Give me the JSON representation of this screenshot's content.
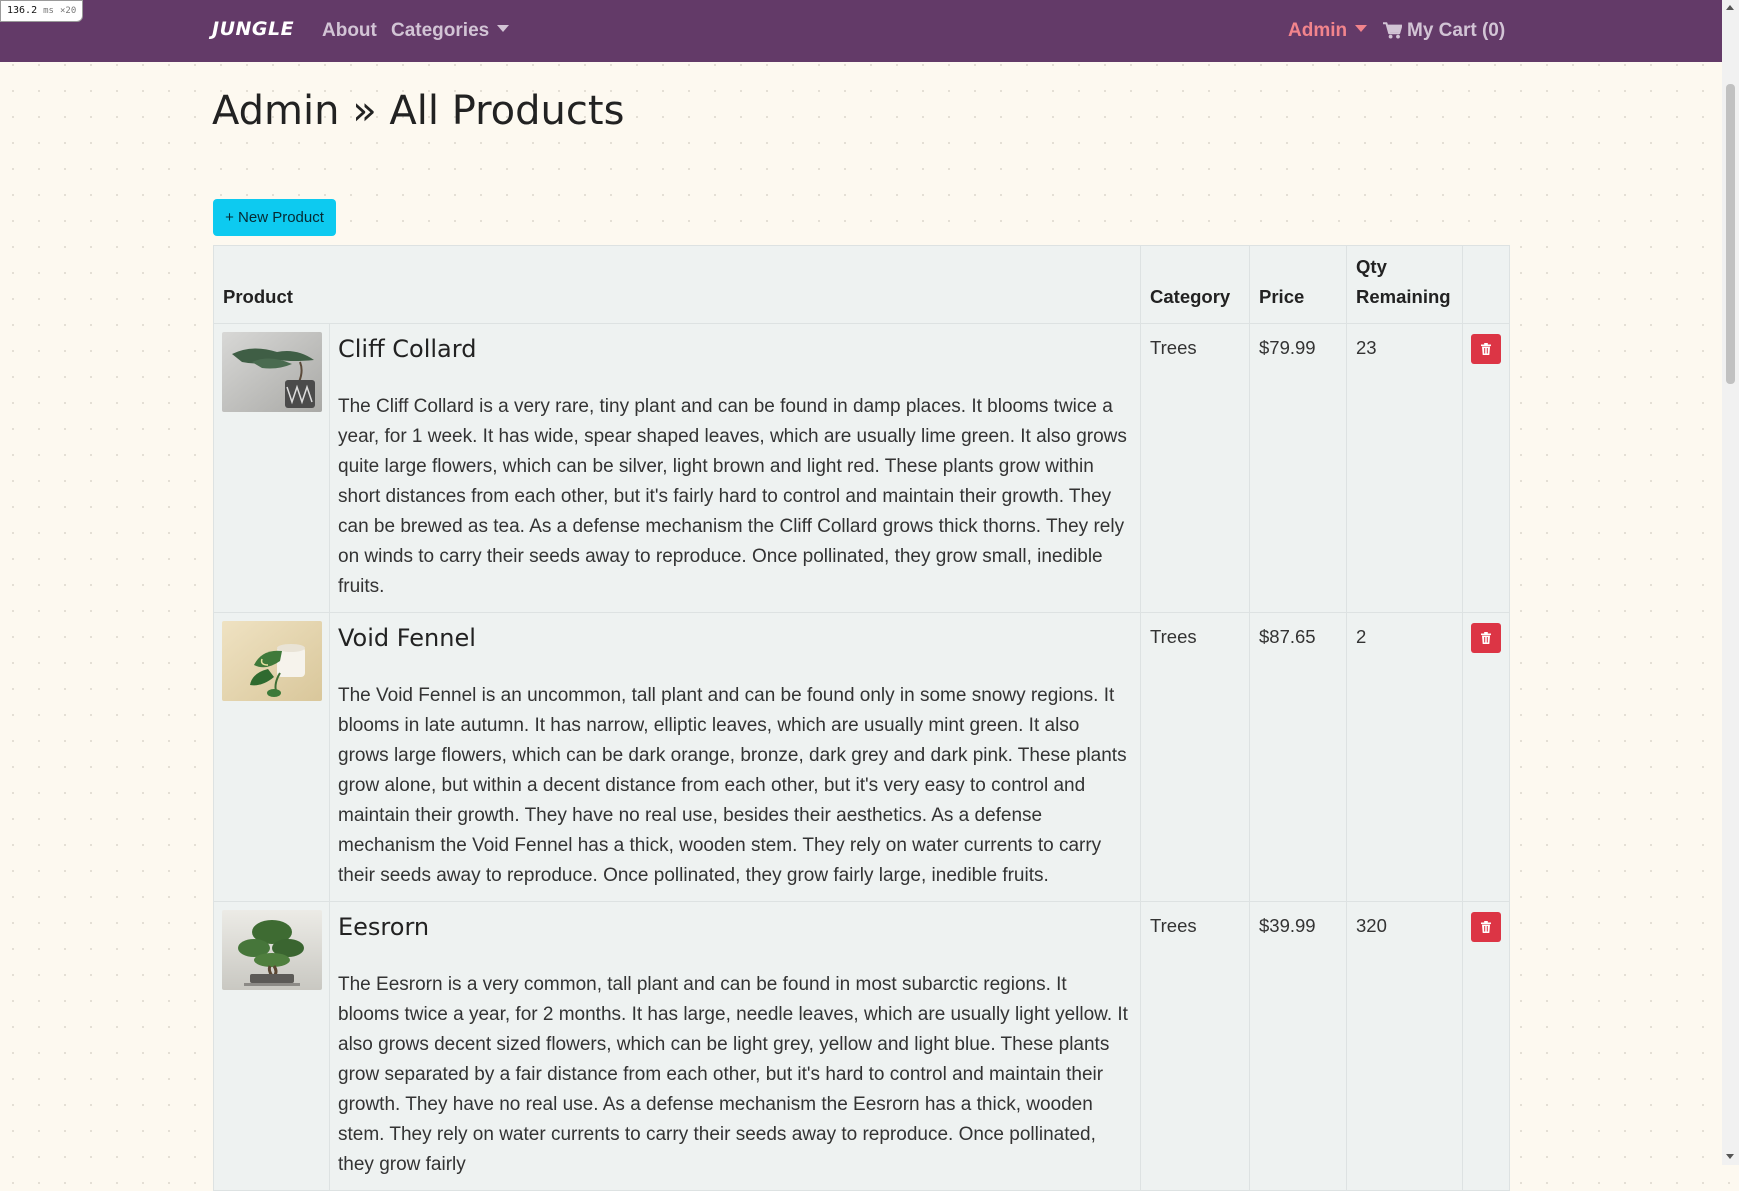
{
  "perf_overlay": {
    "value": "136.2",
    "unit": "ms",
    "multiplier": "×20"
  },
  "navbar": {
    "brand": "JUNGLE",
    "about": "About",
    "categories": "Categories",
    "admin": "Admin",
    "cart": "My Cart (0)",
    "colors": {
      "background": "#633a68",
      "link": "#d2c4d5",
      "admin": "#f2848c"
    }
  },
  "page": {
    "title": "Admin » All Products",
    "new_product_button": "+ New Product"
  },
  "table": {
    "headers": {
      "product": "Product",
      "category": "Category",
      "price": "Price",
      "qty": "Qty Remaining"
    },
    "rows": [
      {
        "name": "Cliff Collard",
        "description": "The Cliff Collard is a very rare, tiny plant and can be found in damp places. It blooms twice a year, for 1 week. It has wide, spear shaped leaves, which are usually lime green. It also grows quite large flowers, which can be silver, light brown and light red. These plants grow within short distances from each other, but it's fairly hard to control and maintain their growth. They can be brewed as tea. As a defense mechanism the Cliff Collard grows thick thorns. They rely on winds to carry their seeds away to reproduce. Once pollinated, they grow small, inedible fruits.",
        "category": "Trees",
        "price": "$79.99",
        "qty": "23",
        "image": "juniper-bonsai-in-patterned-pot"
      },
      {
        "name": "Void Fennel",
        "description": "The Void Fennel is an uncommon, tall plant and can be found only in some snowy regions. It blooms in late autumn. It has narrow, elliptic leaves, which are usually mint green. It also grows large flowers, which can be dark orange, bronze, dark grey and dark pink. These plants grow alone, but within a decent distance from each other, but it's very easy to control and maintain their growth. They have no real use, besides their aesthetics. As a defense mechanism the Void Fennel has a thick, wooden stem. They rely on water currents to carry their seeds away to reproduce. Once pollinated, they grow fairly large, inedible fruits.",
        "category": "Trees",
        "price": "$87.65",
        "qty": "2",
        "image": "pothos-in-white-cup"
      },
      {
        "name": "Eesrorn",
        "description": "The Eesrorn is a very common, tall plant and can be found in most subarctic regions. It blooms twice a year, for 2 months. It has large, needle leaves, which are usually light yellow. It also grows decent sized flowers, which can be light grey, yellow and light blue. These plants grow separated by a fair distance from each other, but it's hard to control and maintain their growth. They have no real use. As a defense mechanism the Eesrorn has a thick, wooden stem. They rely on water currents to carry their seeds away to reproduce. Once pollinated, they grow fairly",
        "category": "Trees",
        "price": "$39.99",
        "qty": "320",
        "image": "bonsai-tree-on-tray"
      }
    ]
  },
  "colors": {
    "new_button": "#0dcaf0",
    "delete_button": "#dc3545",
    "page_background": "#fdf9f0",
    "table_background": "#eef2f1"
  },
  "icons": {
    "delete": "trash-icon",
    "cart": "shopping-cart-icon",
    "dropdown": "caret-down-icon"
  }
}
